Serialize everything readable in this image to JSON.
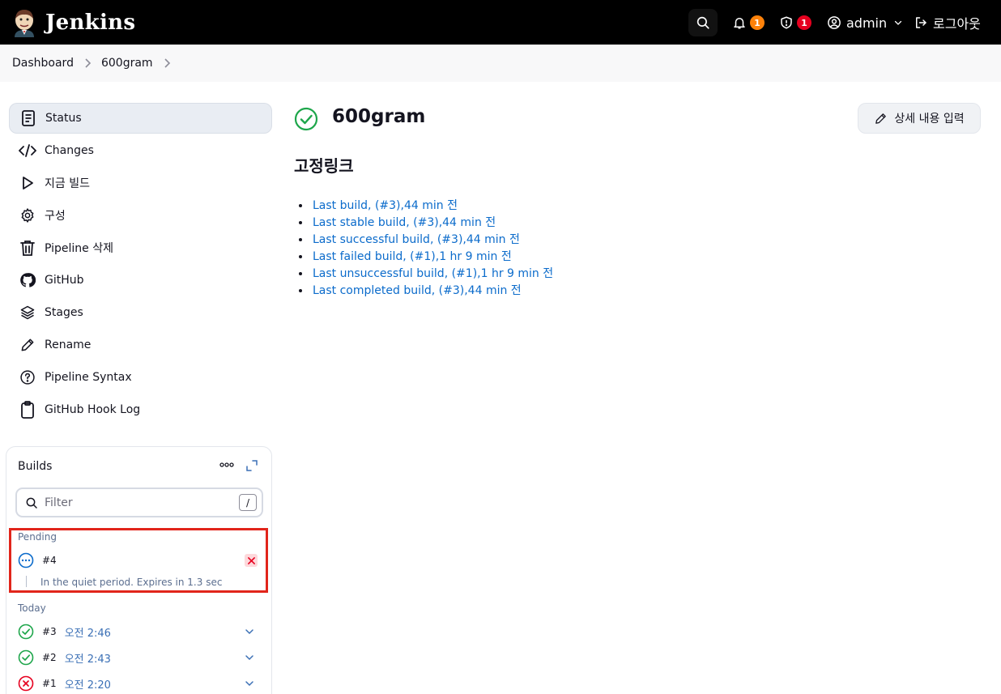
{
  "header": {
    "brand": "Jenkins",
    "notifications_count": "1",
    "security_count": "1",
    "user": "admin",
    "logout": "로그아웃"
  },
  "breadcrumb": {
    "items": [
      "Dashboard",
      "600gram"
    ]
  },
  "tasks": [
    {
      "label": "Status",
      "icon": "document-icon"
    },
    {
      "label": "Changes",
      "icon": "code-icon"
    },
    {
      "label": "지금 빌드",
      "icon": "play-icon"
    },
    {
      "label": "구성",
      "icon": "gear-icon"
    },
    {
      "label": "Pipeline 삭제",
      "icon": "trash-icon"
    },
    {
      "label": "GitHub",
      "icon": "github-icon"
    },
    {
      "label": "Stages",
      "icon": "layers-icon"
    },
    {
      "label": "Rename",
      "icon": "pencil-icon"
    },
    {
      "label": "Pipeline Syntax",
      "icon": "help-icon"
    },
    {
      "label": "GitHub Hook Log",
      "icon": "clipboard-icon"
    }
  ],
  "builds": {
    "title": "Builds",
    "filter_placeholder": "Filter",
    "filter_shortcut": "/",
    "pending_label": "Pending",
    "pending": {
      "number": "#4",
      "message": "In the quiet period. Expires in 1.3 sec"
    },
    "today_label": "Today",
    "items": [
      {
        "number": "#3",
        "time": "오전 2:46",
        "status": "success"
      },
      {
        "number": "#2",
        "time": "오전 2:43",
        "status": "success"
      },
      {
        "number": "#1",
        "time": "오전 2:20",
        "status": "failed"
      }
    ]
  },
  "main": {
    "title": "600gram",
    "description_button": "상세 내용 입력",
    "permalinks_title": "고정링크",
    "permalinks": [
      "Last build, (#3),44 min 전",
      "Last stable build, (#3),44 min 전",
      "Last successful build, (#3),44 min 전",
      "Last failed build, (#1),1 hr 9 min 전",
      "Last unsuccessful build, (#1),1 hr 9 min 전",
      "Last completed build, (#3),44 min 전"
    ]
  },
  "colors": {
    "success": "#1ea64b",
    "failed": "#e6001f",
    "link": "#0b6bcb",
    "pending": "#0b6bcb",
    "highlight": "#e1251b"
  }
}
